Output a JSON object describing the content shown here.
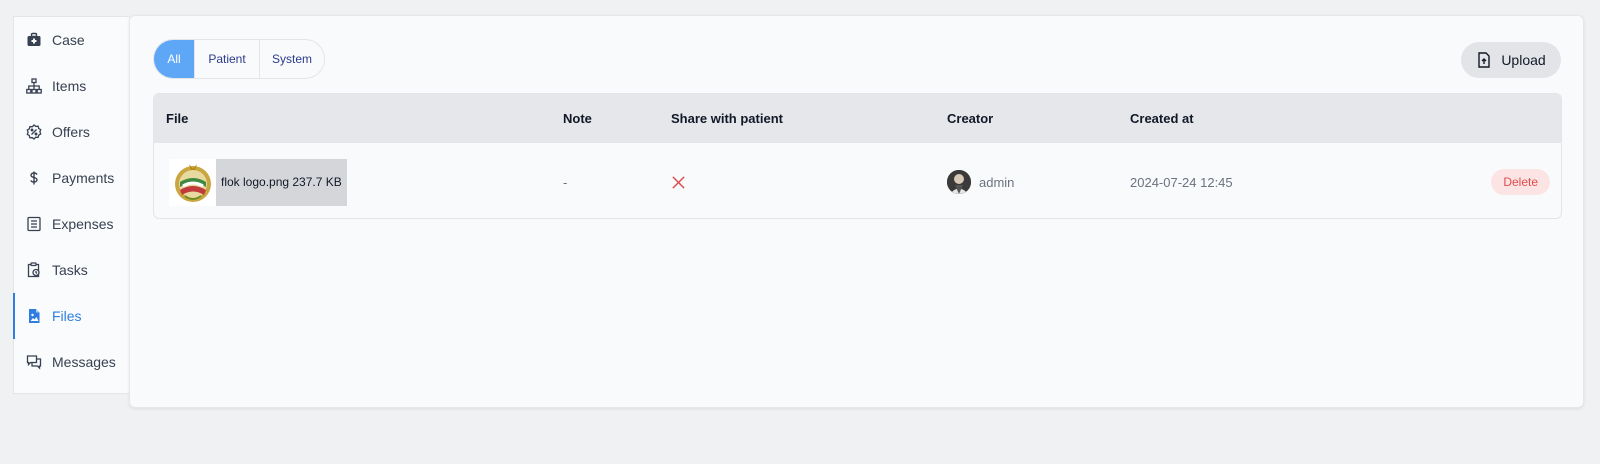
{
  "sidebar": {
    "items": [
      {
        "label": "Case",
        "icon": "medkit-icon"
      },
      {
        "label": "Items",
        "icon": "sitemap-icon"
      },
      {
        "label": "Offers",
        "icon": "discount-badge-icon"
      },
      {
        "label": "Payments",
        "icon": "dollar-icon"
      },
      {
        "label": "Expenses",
        "icon": "receipt-list-icon"
      },
      {
        "label": "Tasks",
        "icon": "clipboard-clock-icon"
      },
      {
        "label": "Files",
        "icon": "file-image-icon"
      },
      {
        "label": "Messages",
        "icon": "chat-bubbles-icon"
      }
    ],
    "active": "Files"
  },
  "filters": {
    "all": "All",
    "patient": "Patient",
    "system": "System",
    "selected": "All"
  },
  "toolbar": {
    "upload_label": "Upload"
  },
  "table": {
    "headers": {
      "file": "File",
      "note": "Note",
      "share": "Share with patient",
      "creator": "Creator",
      "created_at": "Created at"
    },
    "rows": [
      {
        "file_name": "flok logo.png 237.7 KB",
        "note": "-",
        "shared": false,
        "creator": "admin",
        "created_at": "2024-07-24 12:45",
        "delete_label": "Delete"
      }
    ]
  },
  "colors": {
    "accent": "#2f7de1",
    "filter_active": "#5ea7f7",
    "danger": "#e04b4b",
    "danger_bg": "#fde4e4"
  }
}
